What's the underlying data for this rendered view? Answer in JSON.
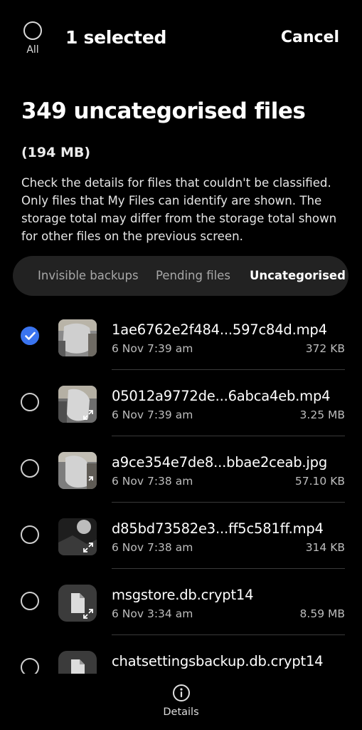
{
  "header": {
    "all_label": "All",
    "selected_text": "1 selected",
    "cancel_label": "Cancel"
  },
  "title": "349 uncategorised files",
  "size": "(194  MB)",
  "description": "Check the details for files that couldn't be classified. Only files that My Files can identify are shown. The storage total may differ from the storage total shown for other files on the previous screen.",
  "tabs": [
    {
      "label": "Invisible backups",
      "active": false
    },
    {
      "label": "Pending files",
      "active": false
    },
    {
      "label": "Uncategorised",
      "active": true
    }
  ],
  "files": [
    {
      "name": "1ae6762e2f484...597c84d.mp4",
      "date": "6 Nov 7:39 am",
      "size": "372 KB",
      "selected": true,
      "thumb": "video-thumbnail"
    },
    {
      "name": "05012a9772de...6abca4eb.mp4",
      "date": "6 Nov 7:39 am",
      "size": "3.25 MB",
      "selected": false,
      "thumb": "video-thumbnail"
    },
    {
      "name": "a9ce354e7de8...bbae2ceab.jpg",
      "date": "6 Nov 7:38 am",
      "size": "57.10 KB",
      "selected": false,
      "thumb": "image-thumbnail"
    },
    {
      "name": "d85bd73582e3...ff5c581ff.mp4",
      "date": "6 Nov 7:38 am",
      "size": "314 KB",
      "selected": false,
      "thumb": "video-thumbnail-dark"
    },
    {
      "name": "msgstore.db.crypt14",
      "date": "6 Nov 3:34 am",
      "size": "8.59 MB",
      "selected": false,
      "thumb": "document-icon"
    },
    {
      "name": "chatsettingsbackup.db.crypt14",
      "date": "",
      "size": "",
      "selected": false,
      "thumb": "document-icon"
    }
  ],
  "bottom": {
    "details_label": "Details",
    "details_icon": "info-icon"
  },
  "colors": {
    "accent": "#3a74f0",
    "background": "#000000",
    "tab_bar": "#222222"
  }
}
